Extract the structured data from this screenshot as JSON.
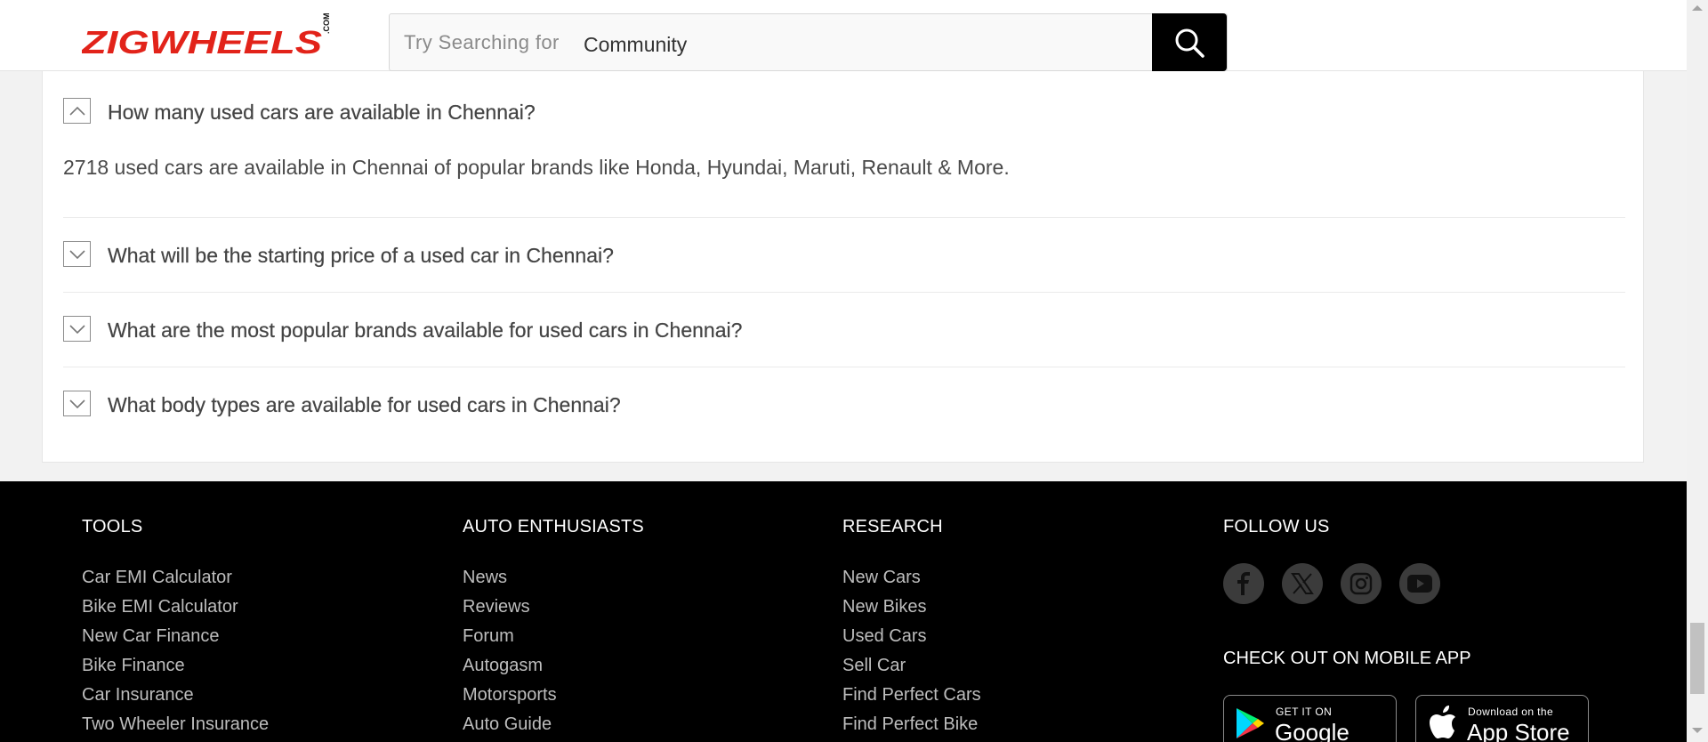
{
  "header": {
    "logo_text": "ZIGWHEELS",
    "logo_suffix": ".COM",
    "search_placeholder": "Try Searching for",
    "search_term": "Community"
  },
  "faq": {
    "items": [
      {
        "question": "How many used cars are available in Chennai?",
        "answer": "2718 used cars are available in Chennai of popular brands like Honda, Hyundai, Maruti, Renault & More.",
        "expanded": true
      },
      {
        "question": "What will be the starting price of a used car in Chennai?",
        "expanded": false
      },
      {
        "question": "What are the most popular brands available for used cars in Chennai?",
        "expanded": false
      },
      {
        "question": "What body types are available for used cars in Chennai?",
        "expanded": false
      }
    ]
  },
  "footer": {
    "tools": {
      "title": "TOOLS",
      "links": [
        "Car EMI Calculator",
        "Bike EMI Calculator",
        "New Car Finance",
        "Bike Finance",
        "Car Insurance",
        "Two Wheeler Insurance"
      ]
    },
    "enthusiasts": {
      "title": "AUTO ENTHUSIASTS",
      "links": [
        "News",
        "Reviews",
        "Forum",
        "Autogasm",
        "Motorsports",
        "Auto Guide"
      ]
    },
    "research": {
      "title": "RESEARCH",
      "links": [
        "New Cars",
        "New Bikes",
        "Used Cars",
        "Sell Car",
        "Find Perfect Cars",
        "Find Perfect Bike"
      ]
    },
    "follow": {
      "title": "FOLLOW US",
      "icons": [
        "facebook-icon",
        "x-icon",
        "instagram-icon",
        "youtube-icon"
      ]
    },
    "app": {
      "title": "CHECK OUT ON MOBILE APP",
      "google_small": "GET IT ON",
      "google_big": "Google Play",
      "apple_small": "Download on the",
      "apple_big": "App Store"
    }
  },
  "colors": {
    "brand_red": "#e2231a",
    "footer_bg": "#000000",
    "search_button": "#000000"
  }
}
